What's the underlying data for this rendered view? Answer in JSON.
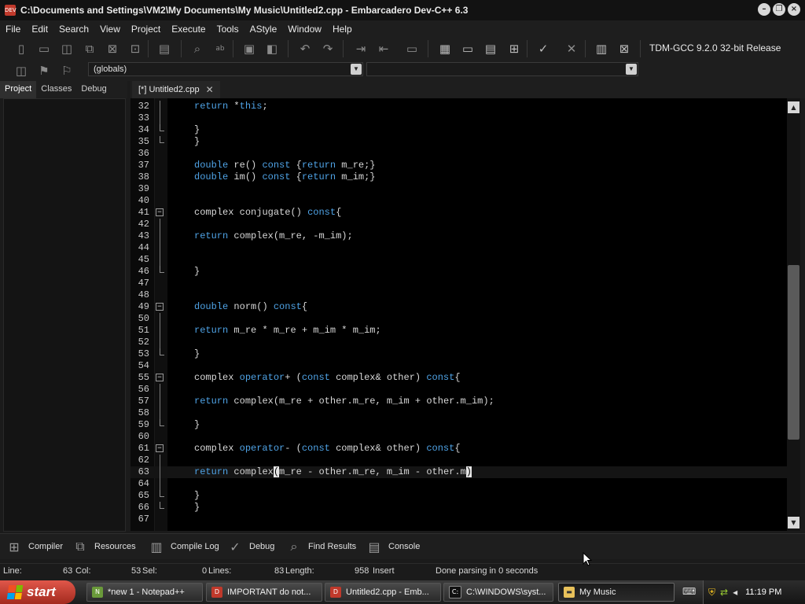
{
  "window": {
    "title": "C:\\Documents and Settings\\VM2\\My Documents\\My Music\\Untitled2.cpp - Embarcadero Dev-C++ 6.3",
    "app_icon": "DEV",
    "controls": [
      "minimize-icon",
      "restore-icon",
      "close-icon"
    ]
  },
  "menu": [
    "File",
    "Edit",
    "Search",
    "View",
    "Project",
    "Execute",
    "Tools",
    "AStyle",
    "Window",
    "Help"
  ],
  "toolbar": {
    "compiler": "TDM-GCC 9.2.0 32-bit Release",
    "scope_dropdown": "(globals)",
    "function_dropdown": ""
  },
  "left_panel": {
    "tabs": [
      "Project",
      "Classes",
      "Debug"
    ],
    "active_tab": "Project"
  },
  "editor": {
    "tab_label": "[*] Untitled2.cpp",
    "accent_keyword_color": "#4fa3e6",
    "lines": [
      {
        "n": "32",
        "code": "return *this;",
        "fold": "line"
      },
      {
        "n": "33",
        "code": "",
        "fold": "line"
      },
      {
        "n": "34",
        "code": "}",
        "fold": "end"
      },
      {
        "n": "35",
        "code": "}",
        "fold": "end"
      },
      {
        "n": "36",
        "code": "",
        "fold": "none"
      },
      {
        "n": "37",
        "code": "double re() const {return m_re;}",
        "fold": "none"
      },
      {
        "n": "38",
        "code": "double im() const {return m_im;}",
        "fold": "none"
      },
      {
        "n": "39",
        "code": "",
        "fold": "none"
      },
      {
        "n": "40",
        "code": "",
        "fold": "none"
      },
      {
        "n": "41",
        "code": "complex conjugate() const{",
        "fold": "box"
      },
      {
        "n": "42",
        "code": "",
        "fold": "line"
      },
      {
        "n": "43",
        "code": "return complex(m_re, -m_im);",
        "fold": "line"
      },
      {
        "n": "44",
        "code": "",
        "fold": "line"
      },
      {
        "n": "45",
        "code": "",
        "fold": "line"
      },
      {
        "n": "46",
        "code": "}",
        "fold": "end"
      },
      {
        "n": "47",
        "code": "",
        "fold": "none"
      },
      {
        "n": "48",
        "code": "",
        "fold": "none"
      },
      {
        "n": "49",
        "code": "double norm() const{",
        "fold": "box"
      },
      {
        "n": "50",
        "code": "",
        "fold": "line"
      },
      {
        "n": "51",
        "code": "return m_re * m_re + m_im * m_im;",
        "fold": "line"
      },
      {
        "n": "52",
        "code": "",
        "fold": "line"
      },
      {
        "n": "53",
        "code": "}",
        "fold": "end"
      },
      {
        "n": "54",
        "code": "",
        "fold": "none"
      },
      {
        "n": "55",
        "code": "complex operator+ (const complex& other) const{",
        "fold": "box"
      },
      {
        "n": "56",
        "code": "",
        "fold": "line"
      },
      {
        "n": "57",
        "code": "return complex(m_re + other.m_re, m_im + other.m_im);",
        "fold": "line"
      },
      {
        "n": "58",
        "code": "",
        "fold": "line"
      },
      {
        "n": "59",
        "code": "}",
        "fold": "end"
      },
      {
        "n": "60",
        "code": "",
        "fold": "none"
      },
      {
        "n": "61",
        "code": "complex operator- (const complex& other) const{",
        "fold": "box"
      },
      {
        "n": "62",
        "code": "",
        "fold": "line"
      },
      {
        "n": "63",
        "code": "return complex(m_re - other.m_re, m_im - other.m)",
        "fold": "line",
        "current": true
      },
      {
        "n": "64",
        "code": "",
        "fold": "line"
      },
      {
        "n": "65",
        "code": "}",
        "fold": "end"
      },
      {
        "n": "66",
        "code": "}",
        "fold": "end"
      },
      {
        "n": "67",
        "code": "",
        "fold": "none"
      }
    ]
  },
  "bottom_tabs": [
    {
      "label": "Compiler",
      "icon": "grid-icon"
    },
    {
      "label": "Resources",
      "icon": "resources-icon"
    },
    {
      "label": "Compile Log",
      "icon": "bar-chart-icon"
    },
    {
      "label": "Debug",
      "icon": "check-icon"
    },
    {
      "label": "Find Results",
      "icon": "find-icon"
    },
    {
      "label": "Console",
      "icon": "console-icon"
    }
  ],
  "status": {
    "line_label": "Line:",
    "line_value": "63",
    "col_label": "Col:",
    "col_value": "53",
    "sel_label": "Sel:",
    "sel_value": "0",
    "lines_label": "Lines:",
    "lines_value": "83",
    "length_label": "Length:",
    "length_value": "958",
    "mode": "Insert",
    "message": "Done parsing in 0 seconds"
  },
  "taskbar": {
    "start_label": "start",
    "items": [
      {
        "label": "*new 1 - Notepad++",
        "icon": "notepadpp-icon",
        "active": false
      },
      {
        "label": "IMPORTANT do not...",
        "icon": "devcpp-icon",
        "active": false
      },
      {
        "label": "Untitled2.cpp - Emb...",
        "icon": "devcpp-icon",
        "active": false
      },
      {
        "label": "C:\\WINDOWS\\syst...",
        "icon": "cmd-icon",
        "active": false
      },
      {
        "label": "My Music",
        "icon": "folder-icon",
        "active": true
      }
    ],
    "clock": "11:19 PM"
  }
}
